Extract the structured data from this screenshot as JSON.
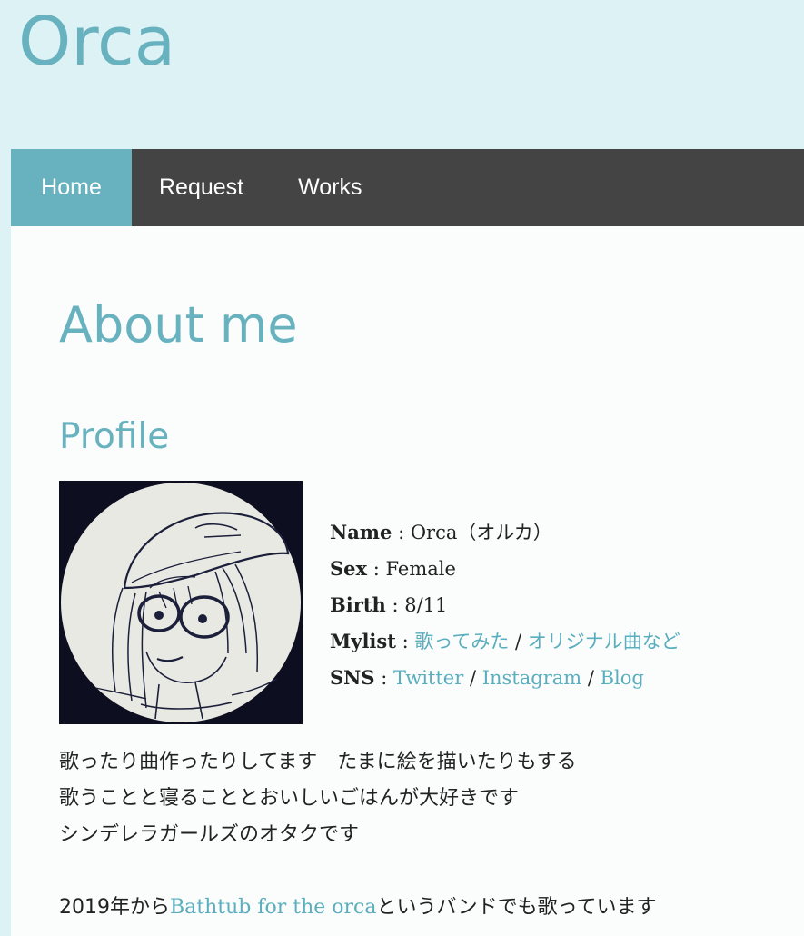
{
  "site": {
    "title": "Orca"
  },
  "nav": {
    "items": [
      {
        "label": "Home",
        "active": true
      },
      {
        "label": "Request",
        "active": false
      },
      {
        "label": "Works",
        "active": false
      }
    ]
  },
  "main": {
    "heading": "About me",
    "profile_heading": "Profile",
    "avatar_icon": "avatar-illustration",
    "profile": {
      "name_label": "Name",
      "name_value": "Orca（オルカ）",
      "sex_label": "Sex",
      "sex_value": "Female",
      "birth_label": "Birth",
      "birth_value": "8/11",
      "mylist_label": "Mylist",
      "mylist_links": [
        "歌ってみた",
        "オリジナル曲など"
      ],
      "sns_label": "SNS",
      "sns_links": [
        "Twitter",
        "Instagram",
        "Blog"
      ],
      "separator": " : ",
      "link_separator": " / "
    },
    "bio": {
      "line1": "歌ったり曲作ったりしてます　たまに絵を描いたりもする",
      "line2": "歌うことと寝ることとおいしいごはんが大好きです",
      "line3": "シンデレラガールズのオタクです",
      "line4_prefix": "2019年から",
      "line4_link": "Bathtub for the orca",
      "line4_suffix": "というバンドでも歌っています"
    }
  },
  "colors": {
    "accent": "#68b2c0",
    "nav_bg": "#444444",
    "page_bg": "#dcf2f5",
    "content_bg": "#fbfdfc",
    "text": "#222222"
  }
}
